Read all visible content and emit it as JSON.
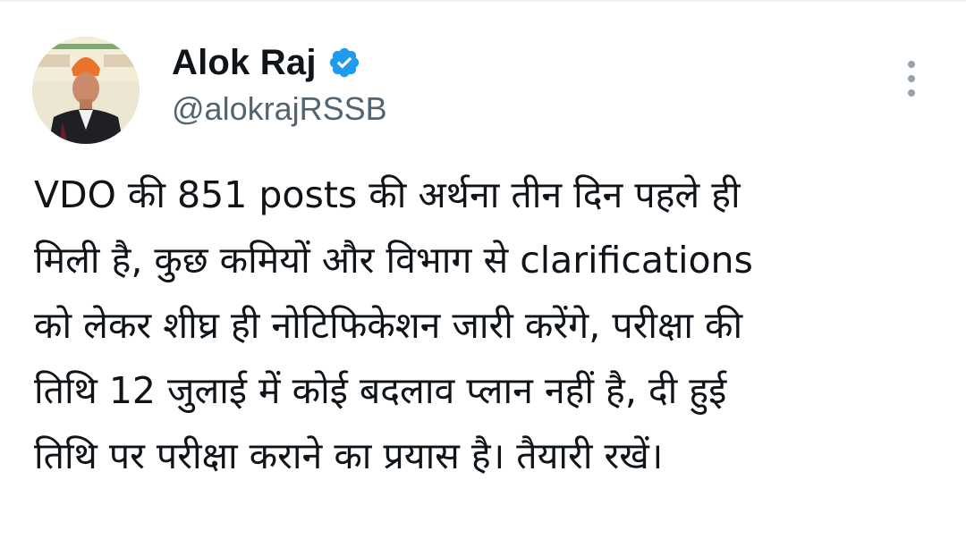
{
  "author": {
    "display_name": "Alok Raj",
    "handle": "@alokrajRSSB",
    "verified": true,
    "verified_color": "#1d9bf0",
    "avatar_icon": "profile-photo"
  },
  "tweet": {
    "lines": [
      "VDO की 851 posts की अर्थना तीन दिन पहले ही",
      "मिली है, कुछ कमियों और विभाग से clarifications",
      "को लेकर शीघ्र ही नोटिफिकेशन जारी करेंगे, परीक्षा की",
      "तिथि 12 जुलाई में कोई बदलाव प्लान नहीं है, दी हुई",
      "तिथि पर परीक्षा कराने का प्रयास है। तैयारी रखें।"
    ]
  },
  "actions": {
    "more_icon": "more-vertical-icon"
  }
}
